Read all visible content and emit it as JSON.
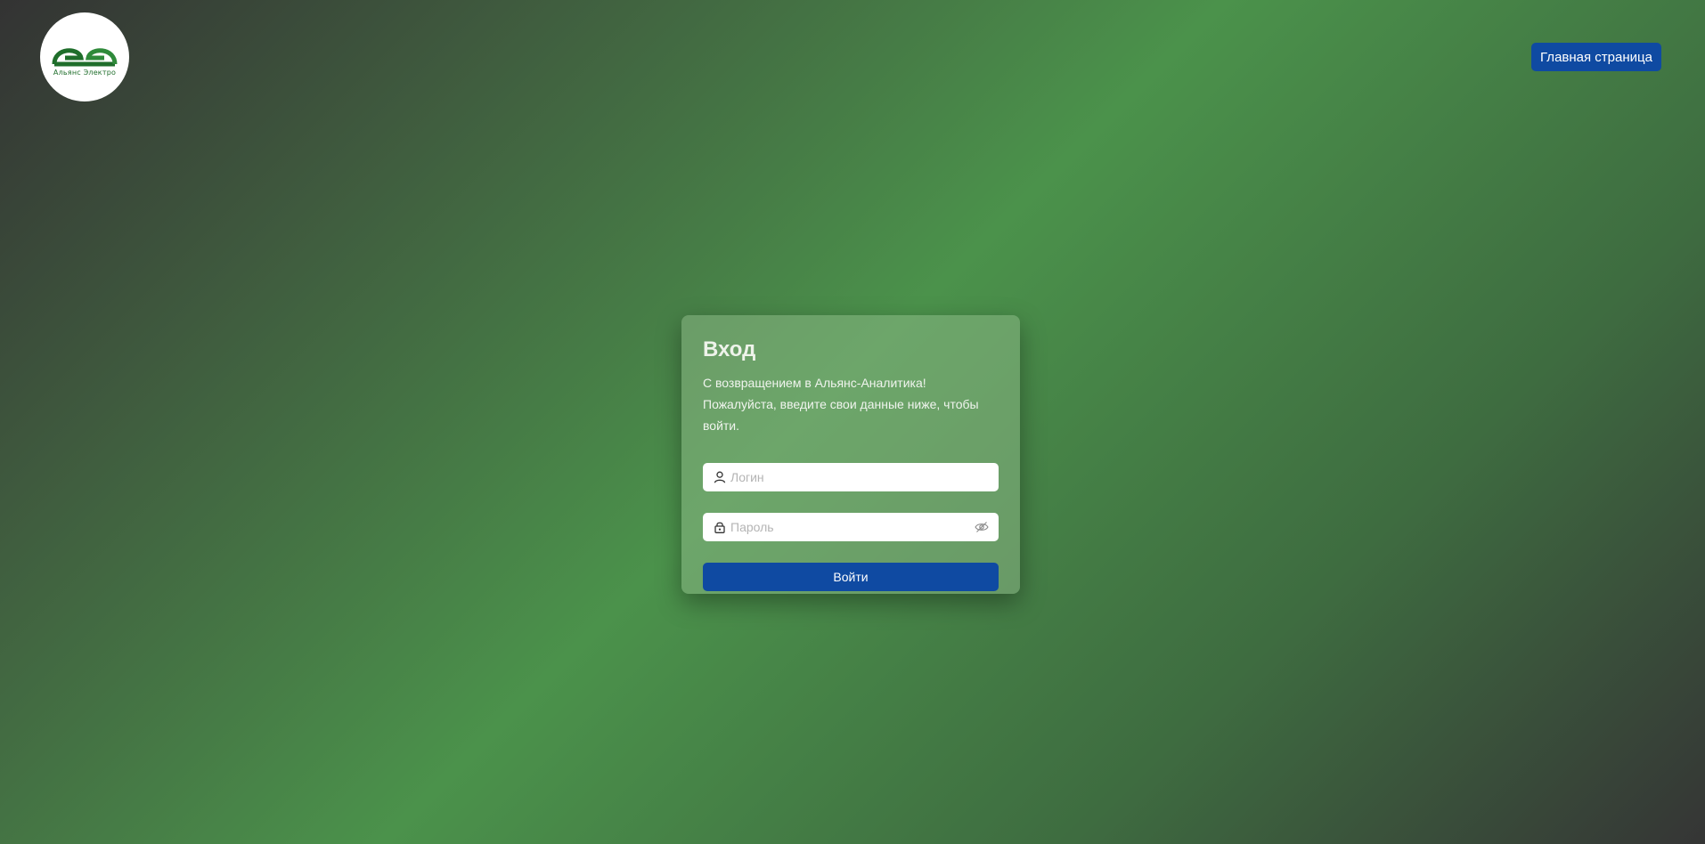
{
  "logo": {
    "text": "Альянс Электро",
    "icon": "alliance-electro-logo",
    "color": "#1f6e2b"
  },
  "header": {
    "home_button_label": "Главная страница"
  },
  "login_card": {
    "title": "Вход",
    "description": "С возвращением в Альянс-Аналитика! Пожалуйста, введите свои данные ниже, чтобы войти.",
    "login_field": {
      "placeholder": "Логин",
      "value": "",
      "icon": "user-icon"
    },
    "password_field": {
      "placeholder": "Пароль",
      "value": "",
      "icon": "lock-icon",
      "toggle_icon": "eye-off-icon"
    },
    "submit_label": "Войти"
  },
  "colors": {
    "primary_button": "#0f4aa2",
    "background_green": "#4b924b",
    "background_dark": "#333333"
  }
}
